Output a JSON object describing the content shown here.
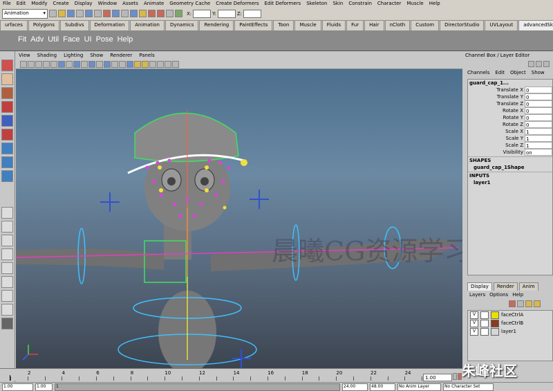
{
  "menubar": [
    "File",
    "Edit",
    "Modify",
    "Create",
    "Display",
    "Window",
    "Assets",
    "Animate",
    "Geometry Cache",
    "Create Deformers",
    "Edit Deformers",
    "Skeleton",
    "Skin",
    "Constrain",
    "Character",
    "Muscle",
    "Help"
  ],
  "status": {
    "mode": "Animation",
    "x_label": "X:",
    "y_label": "Y:",
    "z_label": "Z:"
  },
  "shelf_tabs": [
    "urfaces",
    "Polygons",
    "Subdivs",
    "Deformation",
    "Animation",
    "Dynamics",
    "Rendering",
    "PaintEffects",
    "Toon",
    "Muscle",
    "Fluids",
    "Fur",
    "Hair",
    "nCloth",
    "Custom",
    "DirectorStudio",
    "UVLayout",
    "advancedSkeleton"
  ],
  "shelf_active": "advancedSkeleton",
  "shelf_items": [
    "Fit",
    "Adv",
    "Util",
    "Face",
    "UI",
    "Pose",
    "Help"
  ],
  "panel_menu": [
    "View",
    "Shading",
    "Lighting",
    "Show",
    "Renderer",
    "Panels"
  ],
  "watermark": "晨曦CG资源学习店",
  "channel_box": {
    "header": "Channel Box / Layer Editor",
    "menu": [
      "Channels",
      "Edit",
      "Object",
      "Show"
    ],
    "object": "guard_cap_1...",
    "attributes": [
      {
        "name": "Translate X",
        "value": "0"
      },
      {
        "name": "Translate Y",
        "value": "0"
      },
      {
        "name": "Translate Z",
        "value": "0"
      },
      {
        "name": "Rotate X",
        "value": "0"
      },
      {
        "name": "Rotate Y",
        "value": "0"
      },
      {
        "name": "Rotate Z",
        "value": "0"
      },
      {
        "name": "Scale X",
        "value": "1"
      },
      {
        "name": "Scale Y",
        "value": "1"
      },
      {
        "name": "Scale Z",
        "value": "1"
      },
      {
        "name": "Visibility",
        "value": "on"
      }
    ],
    "shapes_label": "SHAPES",
    "shape": "guard_cap_1Shape",
    "inputs_label": "INPUTS",
    "input": "layer1"
  },
  "layer_editor": {
    "tabs": [
      "Display",
      "Render",
      "Anim"
    ],
    "active_tab": "Display",
    "menu": [
      "Layers",
      "Options",
      "Help"
    ],
    "layers": [
      {
        "v": "V",
        "name": "faceCtrlA",
        "color": "#e8e000"
      },
      {
        "v": "V",
        "name": "faceCtrlB",
        "color": "#8b3a1a"
      },
      {
        "v": "V",
        "name": "layer1",
        "color": ""
      }
    ]
  },
  "timeline": {
    "ticks": [
      "2",
      "4",
      "6",
      "8",
      "10",
      "12",
      "14",
      "16",
      "18",
      "20",
      "22",
      "24"
    ],
    "current_frame": "1.00"
  },
  "range": {
    "start": "1.00",
    "inner_start": "1.00",
    "frame": "1",
    "end": "24.00",
    "outer_end": "48.00",
    "anim_layer": "No Anim Layer",
    "char_set": "No Character Set"
  },
  "brand": "朱峰社区"
}
